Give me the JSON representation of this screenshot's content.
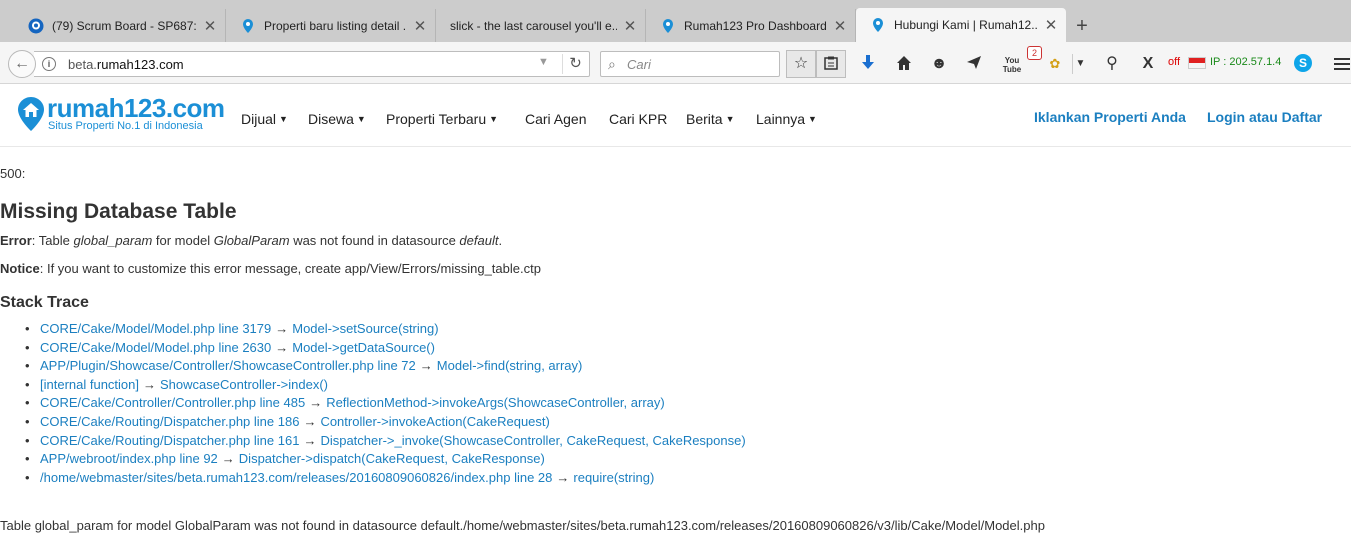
{
  "browser": {
    "tabs": [
      {
        "title": "(79) Scrum Board - SP687: ...",
        "icon": "chat-bubble-icon",
        "active": false
      },
      {
        "title": "Properti baru listing detail ...",
        "icon": "location-pin-icon",
        "active": false
      },
      {
        "title": "slick - the last carousel you'll e...",
        "icon": "",
        "active": false
      },
      {
        "title": "Rumah123 Pro Dashboard...",
        "icon": "location-pin-icon",
        "active": false
      },
      {
        "title": "Hubungi Kami | Rumah12...",
        "icon": "location-pin-icon",
        "active": true
      }
    ],
    "new_tab": "+",
    "url_prefix": "beta.",
    "url_host": "rumah123.com",
    "search_placeholder": "Cari",
    "badge_count": "2",
    "off_label": "off",
    "ip_label": "IP : 202.57.1.4",
    "colors": {
      "chrome": "#cccccc",
      "toolbar": "#f5f5f5",
      "download": "#1a6fd0"
    }
  },
  "site": {
    "logo_text": "rumah123.com",
    "logo_tagline": "Situs Properti No.1 di Indonesia",
    "nav": [
      {
        "label": "Dijual",
        "dropdown": true
      },
      {
        "label": "Disewa",
        "dropdown": true
      },
      {
        "label": "Properti Terbaru",
        "dropdown": true
      },
      {
        "label": "Cari Agen",
        "dropdown": false
      },
      {
        "label": "Cari KPR",
        "dropdown": false
      },
      {
        "label": "Berita",
        "dropdown": true
      },
      {
        "label": "Lainnya",
        "dropdown": true
      }
    ],
    "advertise_link": "Iklankan Properti Anda",
    "login_link": "Login atau Daftar",
    "colors": {
      "brand": "#1b8fd6",
      "link": "#1b7fc0"
    }
  },
  "error": {
    "code": "500:",
    "title": "Missing Database Table",
    "error_label": "Error",
    "error_parts": [
      "Table ",
      "global_param",
      " for model ",
      "GlobalParam",
      " was not found in datasource ",
      "default",
      "."
    ],
    "notice_label": "Notice",
    "notice_text": "If you want to customize this error message, create app/View/Errors/missing_table.ctp",
    "stack_title": "Stack Trace",
    "stack": [
      {
        "file": "CORE/Cake/Model/Model.php line 3179",
        "call": "Model->setSource(string)"
      },
      {
        "file": "CORE/Cake/Model/Model.php line 2630",
        "call": "Model->getDataSource()"
      },
      {
        "file": "APP/Plugin/Showcase/Controller/ShowcaseController.php line 72",
        "call": "Model->find(string, array)"
      },
      {
        "file": "[internal function]",
        "call": "ShowcaseController->index()"
      },
      {
        "file": "CORE/Cake/Controller/Controller.php line 485",
        "call": "ReflectionMethod->invokeArgs(ShowcaseController, array)"
      },
      {
        "file": "CORE/Cake/Routing/Dispatcher.php line 186",
        "call": "Controller->invokeAction(CakeRequest)"
      },
      {
        "file": "CORE/Cake/Routing/Dispatcher.php line 161",
        "call": "Dispatcher->_invoke(ShowcaseController, CakeRequest, CakeResponse)"
      },
      {
        "file": "APP/webroot/index.php line 92",
        "call": "Dispatcher->dispatch(CakeRequest, CakeResponse)"
      },
      {
        "file": "/home/webmaster/sites/beta.rumah123.com/releases/20160809060826/index.php line 28",
        "call": "require(string)"
      }
    ],
    "arrow": "→",
    "footer_message": "Table global_param for model GlobalParam was not found in datasource default./home/webmaster/sites/beta.rumah123.com/releases/20160809060826/v3/lib/Cake/Model/Model.php"
  }
}
